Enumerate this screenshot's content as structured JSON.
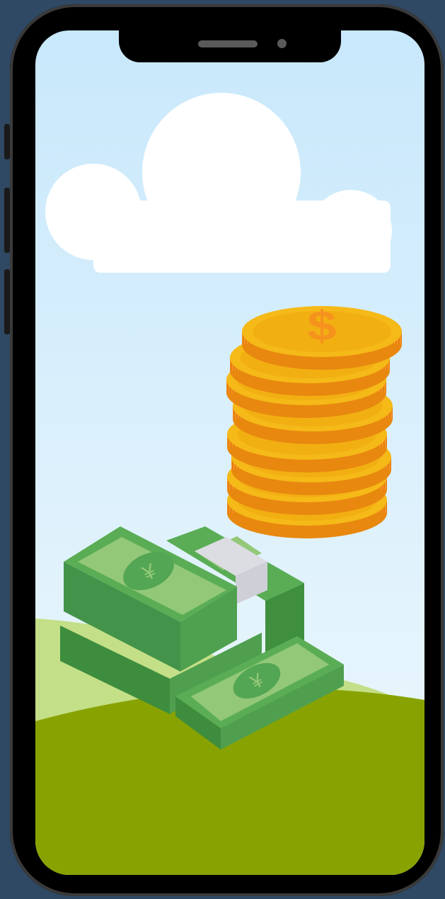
{
  "device": {
    "model": "notched-smartphone",
    "frame_color": "#000000",
    "background_color": "#2f4863"
  },
  "scene": {
    "sky_top_color": "#c8e8fb",
    "sky_bottom_color": "#eef8fd",
    "hill_light_color": "#c3df87",
    "hill_dark_color": "#88a301",
    "cloud_color": "#ffffff",
    "coin_symbol": "$",
    "coin_color": "#f5b918",
    "coin_edge_color": "#f6921e",
    "banknote_symbol": "¥",
    "banknote_color": "#53a653",
    "band_color": "#dcdce3",
    "coin_count": 8
  }
}
